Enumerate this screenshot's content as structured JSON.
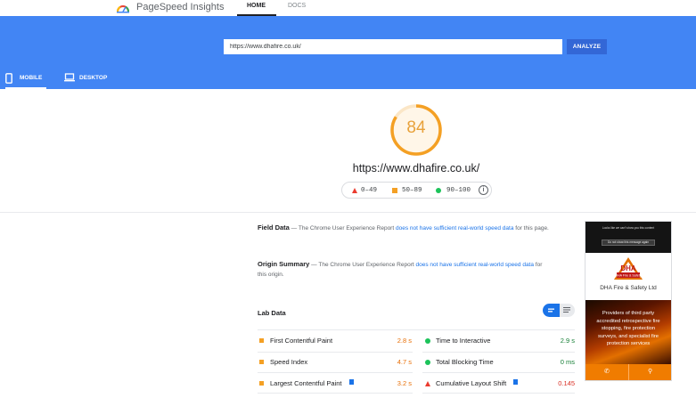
{
  "header": {
    "brand": "PageSpeed Insights",
    "nav": {
      "home": "HOME",
      "docs": "DOCS"
    }
  },
  "hero": {
    "url_value": "https://www.dhafire.co.uk/",
    "analyze_label": "ANALYZE",
    "tabs": {
      "mobile": "MOBILE",
      "desktop": "DESKTOP"
    }
  },
  "score": {
    "value": "84",
    "fraction": 0.84,
    "url": "https://www.dhafire.co.uk/",
    "color": "#f4a024",
    "legend": {
      "poor": "0–49",
      "average": "50–89",
      "good": "90–100",
      "info": "i"
    }
  },
  "field_data": {
    "title": "Field Data",
    "dash": "—",
    "text_before": "The Chrome User Experience Report",
    "link": "does not have sufficient real-world speed data",
    "text_after": "for this page."
  },
  "origin_summary": {
    "title": "Origin Summary",
    "dash": "—",
    "text_before": "The Chrome User Experience Report",
    "link": "does not have sufficient real-world speed data",
    "text_after": "for this origin."
  },
  "lab_data": {
    "title": "Lab Data",
    "metrics_left": [
      {
        "label": "First Contentful Paint",
        "value": "2.8 s",
        "status": "average"
      },
      {
        "label": "Speed Index",
        "value": "4.7 s",
        "status": "average"
      },
      {
        "label": "Largest Contentful Paint",
        "value": "3.2 s",
        "status": "average"
      }
    ],
    "metrics_right": [
      {
        "label": "Time to Interactive",
        "value": "2.9 s",
        "status": "good"
      },
      {
        "label": "Total Blocking Time",
        "value": "0 ms",
        "status": "good"
      },
      {
        "label": "Cumulative Layout Shift",
        "value": "0.145",
        "status": "poor"
      }
    ]
  },
  "preview": {
    "notice": "Looks like we can't show you this content",
    "button": "Do not show this message again",
    "logo": "DHA Fire & Safety",
    "company": "DHA Fire & Safety Ltd",
    "tagline": "Providers of third party accredited retrospective fire stopping, fire protection surveys, and specialist fire protection services"
  },
  "colors": {
    "blue": "#4285f4",
    "analyze": "#3367d6",
    "average": "#f4a024",
    "good": "#1cc35a",
    "poor": "#eb3b2f"
  }
}
